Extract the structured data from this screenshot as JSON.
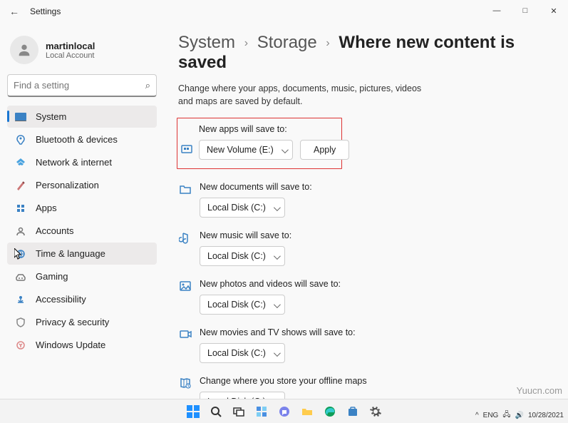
{
  "window": {
    "title": "Settings",
    "controls": {
      "min": "—",
      "max": "□",
      "close": "✕"
    }
  },
  "user": {
    "name": "martinlocal",
    "account": "Local Account"
  },
  "search": {
    "placeholder": "Find a setting"
  },
  "nav": {
    "items": [
      {
        "label": "System",
        "active": true
      },
      {
        "label": "Bluetooth & devices"
      },
      {
        "label": "Network & internet"
      },
      {
        "label": "Personalization"
      },
      {
        "label": "Apps"
      },
      {
        "label": "Accounts"
      },
      {
        "label": "Time & language",
        "hover": true
      },
      {
        "label": "Gaming"
      },
      {
        "label": "Accessibility"
      },
      {
        "label": "Privacy & security"
      },
      {
        "label": "Windows Update"
      }
    ]
  },
  "breadcrumb": {
    "c1": "System",
    "c2": "Storage",
    "c3": "Where new content is saved"
  },
  "subtitle": "Change where your apps, documents, music, pictures, videos and maps are saved by default.",
  "settings": [
    {
      "label": "New apps will save to:",
      "value": "New Volume (E:)",
      "apply": "Apply",
      "highlight": true
    },
    {
      "label": "New documents will save to:",
      "value": "Local Disk (C:)"
    },
    {
      "label": "New music will save to:",
      "value": "Local Disk (C:)"
    },
    {
      "label": "New photos and videos will save to:",
      "value": "Local Disk (C:)"
    },
    {
      "label": "New movies and TV shows will save to:",
      "value": "Local Disk (C:)"
    },
    {
      "label": "Change where you store your offline maps",
      "value": "Local Disk (C:)"
    }
  ],
  "tray": {
    "lang": "ENG",
    "date": "10/28/2021"
  },
  "watermark": "Yuucn.com"
}
